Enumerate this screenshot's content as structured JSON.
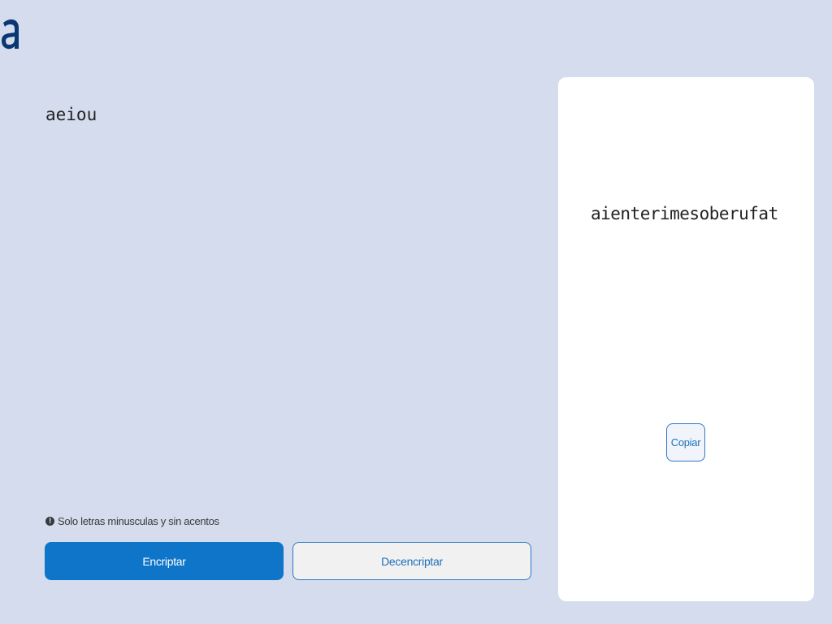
{
  "logo": {
    "icon": "alura-a-logo-icon",
    "color": "#0A3871"
  },
  "encoder": {
    "input_value": "aeiou",
    "hint_icon": "!",
    "hint_text": "Solo letras minusculas y sin acentos",
    "encrypt_label": "Encriptar",
    "decrypt_label": "Decencriptar"
  },
  "output": {
    "result_text": "aienterimesoberufat",
    "copy_label": "Copiar"
  },
  "colors": {
    "background": "#D4DCEE",
    "primary": "#0F75C9",
    "secondary_border": "#2D78C4",
    "card": "#FFFFFF"
  }
}
